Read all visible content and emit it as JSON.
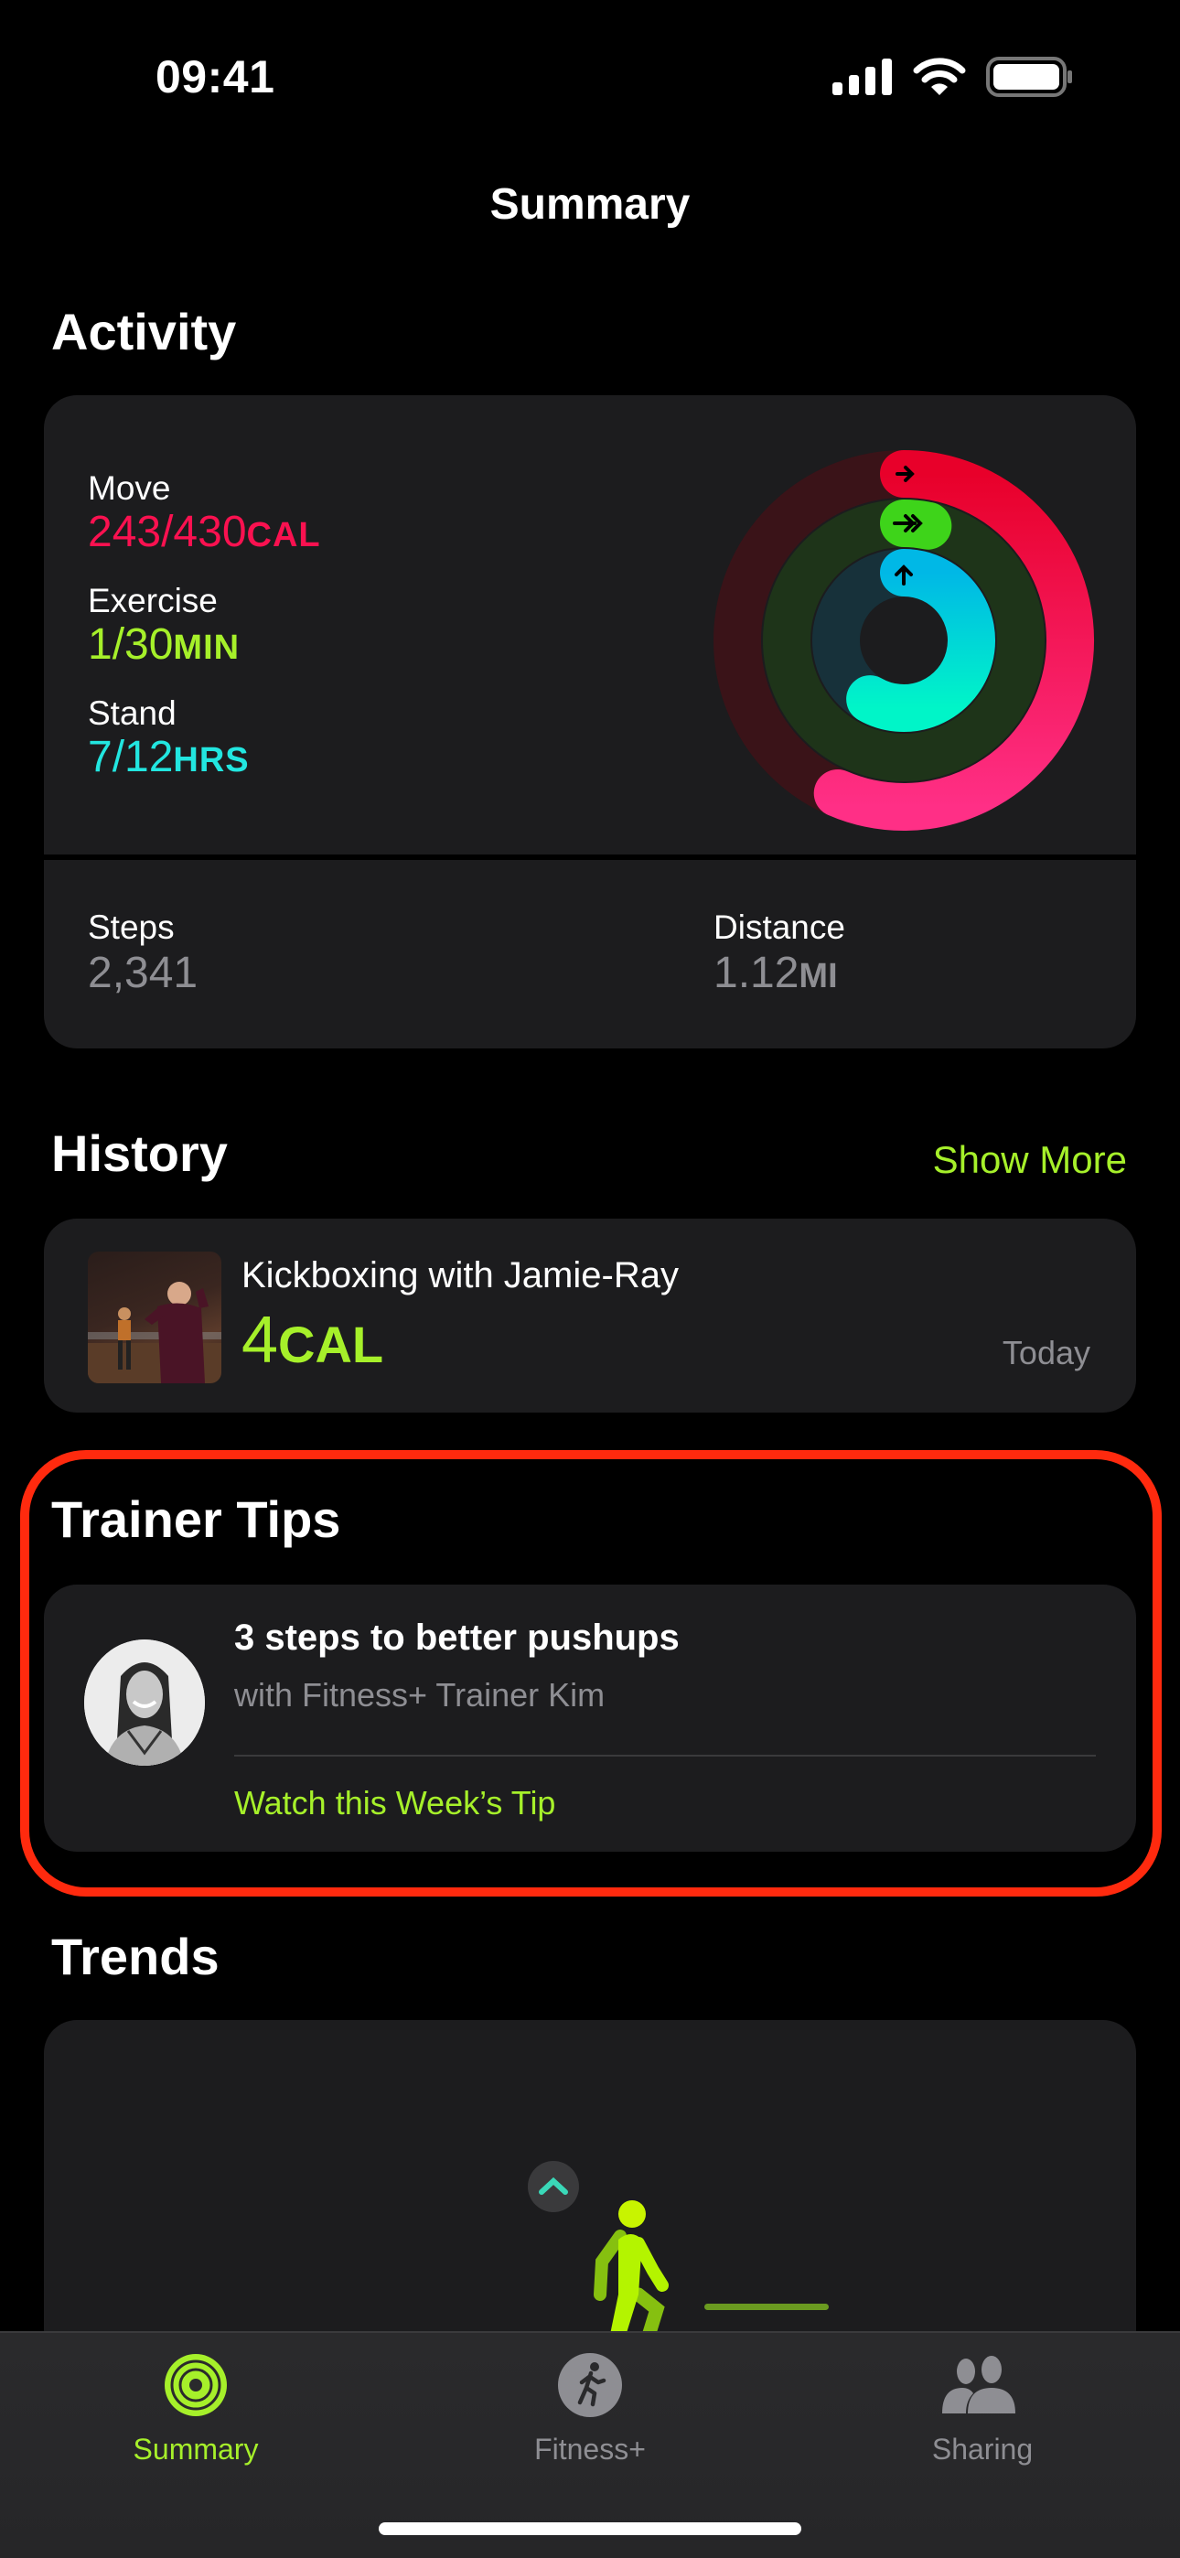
{
  "status_bar": {
    "time": "09:41",
    "icons": [
      "signal-icon",
      "wifi-icon",
      "battery-icon"
    ]
  },
  "nav": {
    "title": "Summary"
  },
  "activity": {
    "section_title": "Activity",
    "move": {
      "label": "Move",
      "value": "243/430",
      "unit": "CAL",
      "progress": 0.565,
      "color": "#fa1150"
    },
    "exercise": {
      "label": "Exercise",
      "value": "1/30",
      "unit": "MIN",
      "progress": 0.033,
      "color": "#a6f02a"
    },
    "stand": {
      "label": "Stand",
      "value": "7/12",
      "unit": "HRS",
      "progress": 0.583,
      "color": "#22e6e0"
    },
    "steps": {
      "label": "Steps",
      "value": "2,341"
    },
    "distance": {
      "label": "Distance",
      "value": "1.12",
      "unit": "MI"
    }
  },
  "history": {
    "section_title": "History",
    "show_more": "Show More",
    "item": {
      "name": "Kickboxing with Jamie-Ray",
      "value": "4",
      "unit": "CAL",
      "date": "Today"
    }
  },
  "trainer_tips": {
    "section_title": "Trainer Tips",
    "title": "3 steps to better pushups",
    "subtitle": "with Fitness+ Trainer Kim",
    "link": "Watch this Week’s Tip"
  },
  "trends": {
    "section_title": "Trends"
  },
  "tab_bar": {
    "tabs": [
      {
        "label": "Summary",
        "icon": "activity-rings-icon",
        "active": true
      },
      {
        "label": "Fitness+",
        "icon": "runner-icon",
        "active": false
      },
      {
        "label": "Sharing",
        "icon": "people-icon",
        "active": false
      }
    ]
  },
  "colors": {
    "accent": "#a6f02a",
    "highlight": "#ff2a0e"
  }
}
